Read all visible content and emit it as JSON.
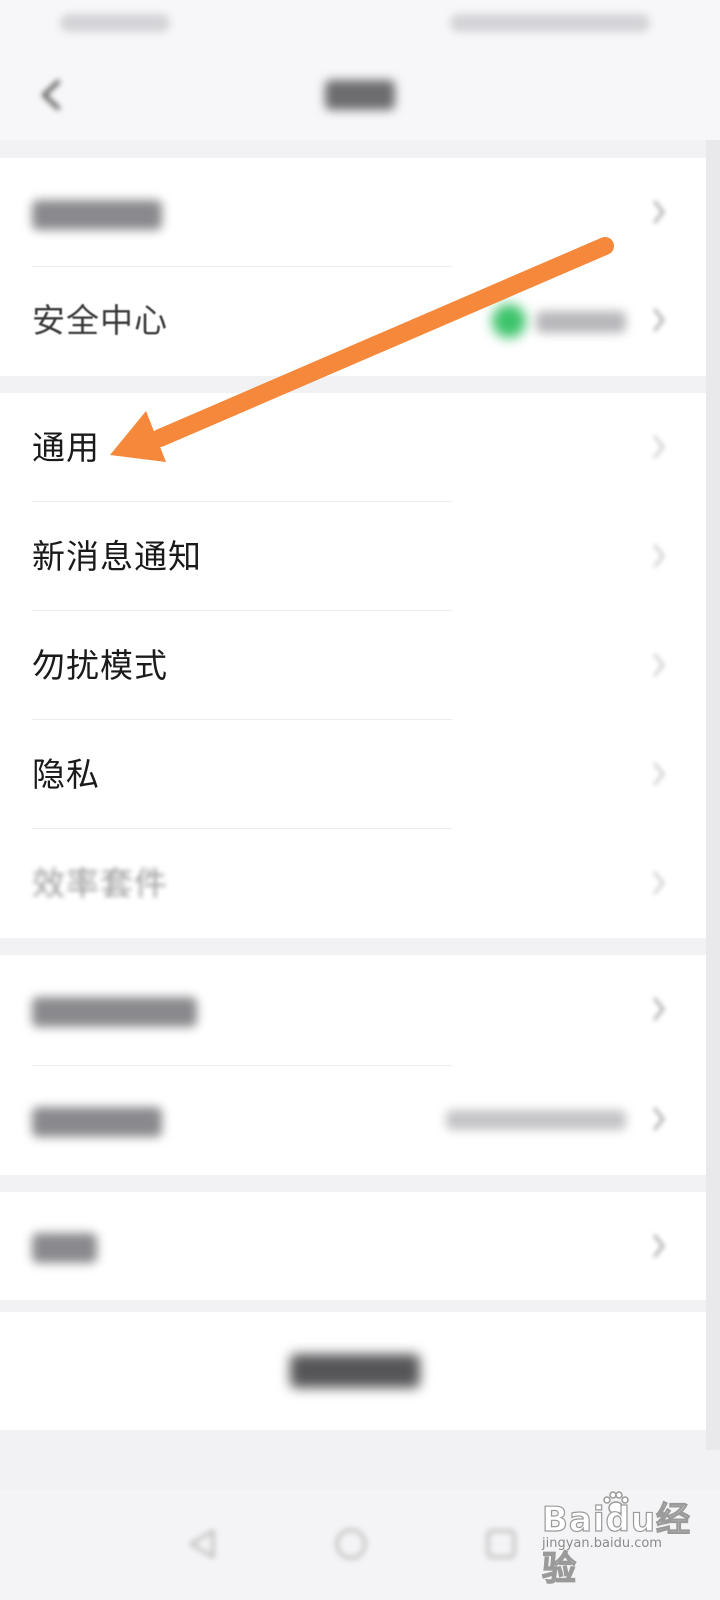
{
  "settings": {
    "items": [
      {
        "label": "安全中心"
      },
      {
        "label": "通用"
      },
      {
        "label": "新消息通知"
      },
      {
        "label": "勿扰模式"
      },
      {
        "label": "隐私"
      },
      {
        "label": "效率套件"
      }
    ]
  },
  "watermark": {
    "brand": "Baidu经验",
    "url": "jingyan.baidu.com"
  },
  "annotation": {
    "color": "#F5883A"
  },
  "icons": {
    "back": "chevron-left-icon",
    "row": "chevron-right-icon",
    "nav": [
      "back-triangle-icon",
      "home-circle-icon",
      "recents-square-icon"
    ]
  }
}
